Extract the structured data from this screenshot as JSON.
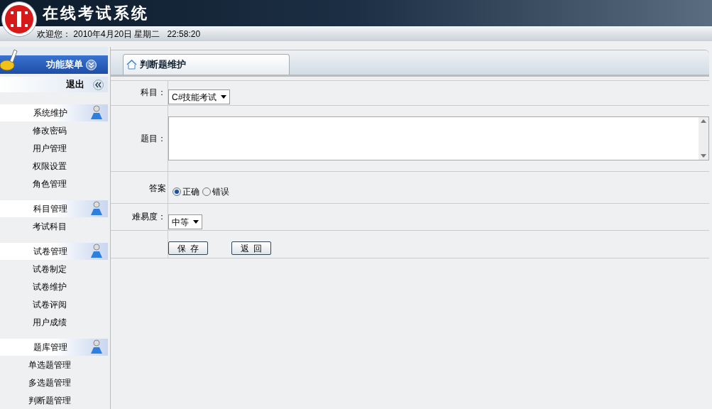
{
  "header": {
    "title": "在线考试系统",
    "welcome": "欢迎您： 2010年4月20日 星期二   22:58:20"
  },
  "sidebar": {
    "menu_title": "功能菜单",
    "logout": "退出",
    "groups": [
      {
        "title": "系统维护",
        "items": [
          "修改密码",
          "用户管理",
          "权限设置",
          "角色管理"
        ]
      },
      {
        "title": "科目管理",
        "items": [
          "考试科目"
        ]
      },
      {
        "title": "试卷管理",
        "items": [
          "试卷制定",
          "试卷维护",
          "试卷评阅",
          "用户成绩"
        ]
      },
      {
        "title": "题库管理",
        "items": [
          "单选题管理",
          "多选题管理",
          "判断题管理"
        ]
      }
    ]
  },
  "tab": {
    "label": "判断题维护",
    "selected": true
  },
  "form": {
    "subject": {
      "label": "科目：",
      "value": "C#技能考试"
    },
    "question": {
      "label": "题目："
    },
    "answer": {
      "label": "答案",
      "options": [
        {
          "label": "正确",
          "selected": true
        },
        {
          "label": "错误",
          "selected": false
        }
      ]
    },
    "difficulty": {
      "label": "难易度：",
      "value": "中等"
    },
    "buttons": [
      "保  存",
      "返  回"
    ]
  }
}
